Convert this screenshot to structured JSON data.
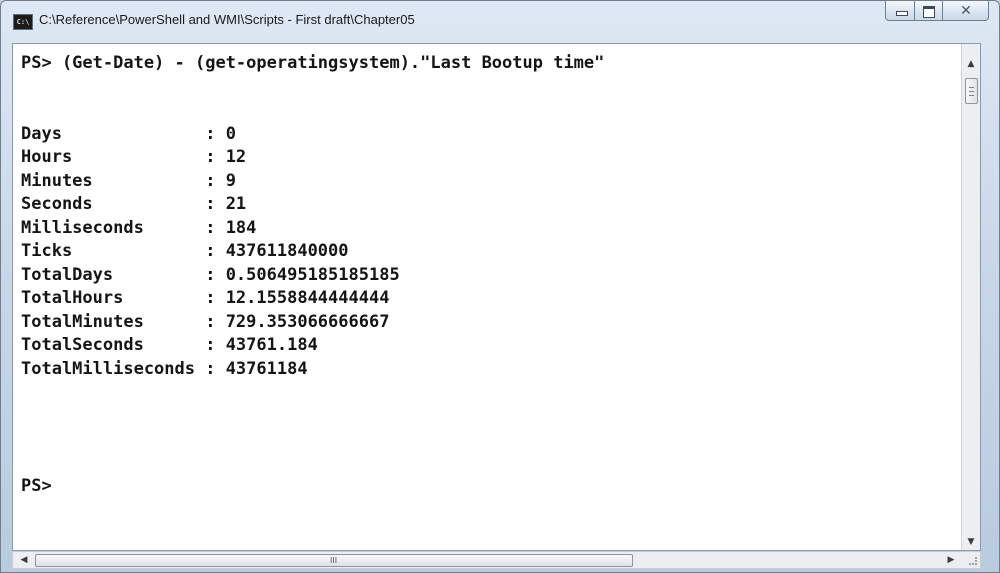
{
  "window": {
    "title": "C:\\Reference\\PowerShell and WMI\\Scripts - First draft\\Chapter05",
    "icon": "console-icon",
    "controls": {
      "minimize": "minimize-icon",
      "maximize": "maximize-icon",
      "close": "close-icon",
      "close_glyph": "✕"
    }
  },
  "console": {
    "lines": [
      "PS> (Get-Date) - (get-operatingsystem).\"Last Bootup time\"",
      "",
      "",
      "Days              : 0",
      "Hours             : 12",
      "Minutes           : 9",
      "Seconds           : 21",
      "Milliseconds      : 184",
      "Ticks             : 437611840000",
      "TotalDays         : 0.506495185185185",
      "TotalHours        : 12.1558844444444",
      "TotalMinutes      : 729.353066666667",
      "TotalSeconds      : 43761.184",
      "TotalMilliseconds : 43761184",
      "",
      "",
      "",
      "",
      "PS>"
    ]
  },
  "scrollbars": {
    "up": "▲",
    "down": "▼",
    "left": "◀",
    "right": "▶",
    "hgrip": "III"
  }
}
